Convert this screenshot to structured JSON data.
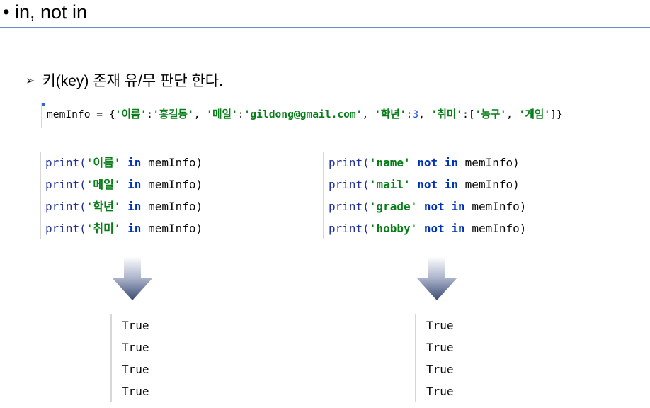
{
  "title": "• in, not in",
  "subtitle": {
    "bullet": "➢",
    "text": "키(key) 존재 유/무 판단 한다."
  },
  "dict_line": {
    "lhs": "memInfo = {",
    "k1": "'이름'",
    "v1": "'홍길동'",
    "k2": "'메일'",
    "v2": "'gildong@gmail.com'",
    "k3": "'학년'",
    "v3": "3",
    "k4": "'취미'",
    "v4a": "'농구'",
    "v4b": "'게임'",
    "close": "]}"
  },
  "left_code": [
    {
      "fn": "print(",
      "key": "'이름'",
      "op": "in",
      "var": "memInfo)"
    },
    {
      "fn": "print(",
      "key": "'메일'",
      "op": "in",
      "var": "memInfo)"
    },
    {
      "fn": "print(",
      "key": "'학년'",
      "op": "in",
      "var": "memInfo)"
    },
    {
      "fn": "print(",
      "key": "'취미'",
      "op": "in",
      "var": "memInfo)"
    }
  ],
  "right_code": [
    {
      "fn": "print(",
      "key": "'name'",
      "op": "not in",
      "var": "memInfo)"
    },
    {
      "fn": "print(",
      "key": "'mail'",
      "op": "not in",
      "var": "memInfo)"
    },
    {
      "fn": "print(",
      "key": "'grade'",
      "op": "not in",
      "var": "memInfo)"
    },
    {
      "fn": "print(",
      "key": "'hobby'",
      "op": "not in",
      "var": "memInfo)"
    }
  ],
  "left_output": [
    "True",
    "True",
    "True",
    "True"
  ],
  "right_output": [
    "True",
    "True",
    "True",
    "True"
  ],
  "icons": {
    "down_arrow": "down-arrow-icon"
  }
}
